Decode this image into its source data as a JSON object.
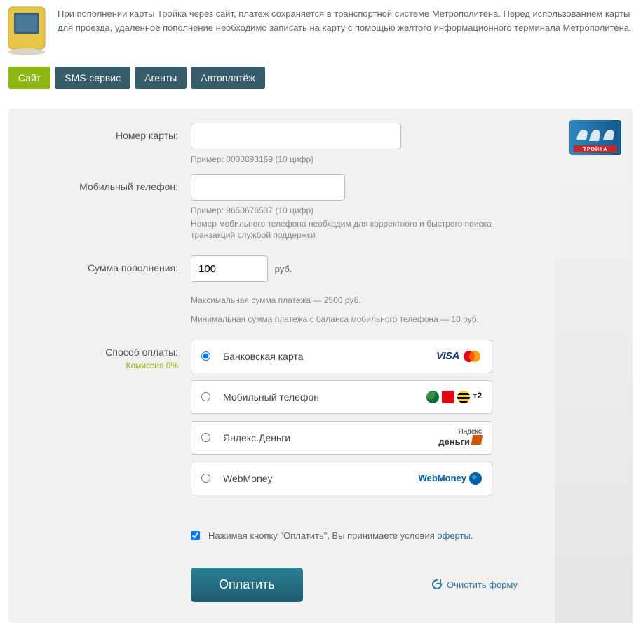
{
  "info_text": "При пополнении карты Тройка через сайт, платеж сохраняется в транспортной системе Метрополитена. Перед использованием карты для проезда, удаленное пополнение необходимо записать на карту с помощью желтого информационного терминала Метрополитена.",
  "tabs": [
    {
      "label": "Сайт",
      "active": true
    },
    {
      "label": "SMS-сервис",
      "active": false
    },
    {
      "label": "Агенты",
      "active": false
    },
    {
      "label": "Автоплатёж",
      "active": false
    }
  ],
  "form": {
    "card_number": {
      "label": "Номер карты:",
      "value": "",
      "hint": "Пример: 0003893169 (10 цифр)"
    },
    "phone": {
      "label": "Мобильный телефон:",
      "value": "",
      "hint1": "Пример: 9650676537 (10 цифр)",
      "hint2": "Номер мобильного телефона необходим для корректного и быстрого поиска транзакций службой поддержки"
    },
    "amount": {
      "label": "Сумма пополнения:",
      "value": "100",
      "unit": "руб.",
      "hint1": "Максимальная сумма платежа — 2500 руб.",
      "hint2": "Минимальная сумма платежа с баланса мобильного телефона — 10 руб."
    },
    "pay_method": {
      "label": "Способ оплаты:",
      "commission": "Комиссия 0%",
      "options": [
        {
          "id": "card",
          "label": "Банковская карта",
          "selected": true
        },
        {
          "id": "mobile",
          "label": "Мобильный телефон",
          "selected": false
        },
        {
          "id": "yandex",
          "label": "Яндекс.Деньги",
          "selected": false
        },
        {
          "id": "webmoney",
          "label": "WebMoney",
          "selected": false
        }
      ]
    },
    "terms": {
      "checked": true,
      "text_prefix": "Нажимая кнопку \"Оплатить\", Вы принимаете условия ",
      "link": "оферты",
      "text_suffix": "."
    },
    "pay_button": "Оплатить",
    "clear_link": "Очистить форму"
  },
  "logos": {
    "visa": "VISA",
    "webmoney": "WebMoney",
    "yandex_small": "Яндекс",
    "yandex_big": "деньги",
    "t2": "т2"
  },
  "troika_label": "ТРОЙКА"
}
